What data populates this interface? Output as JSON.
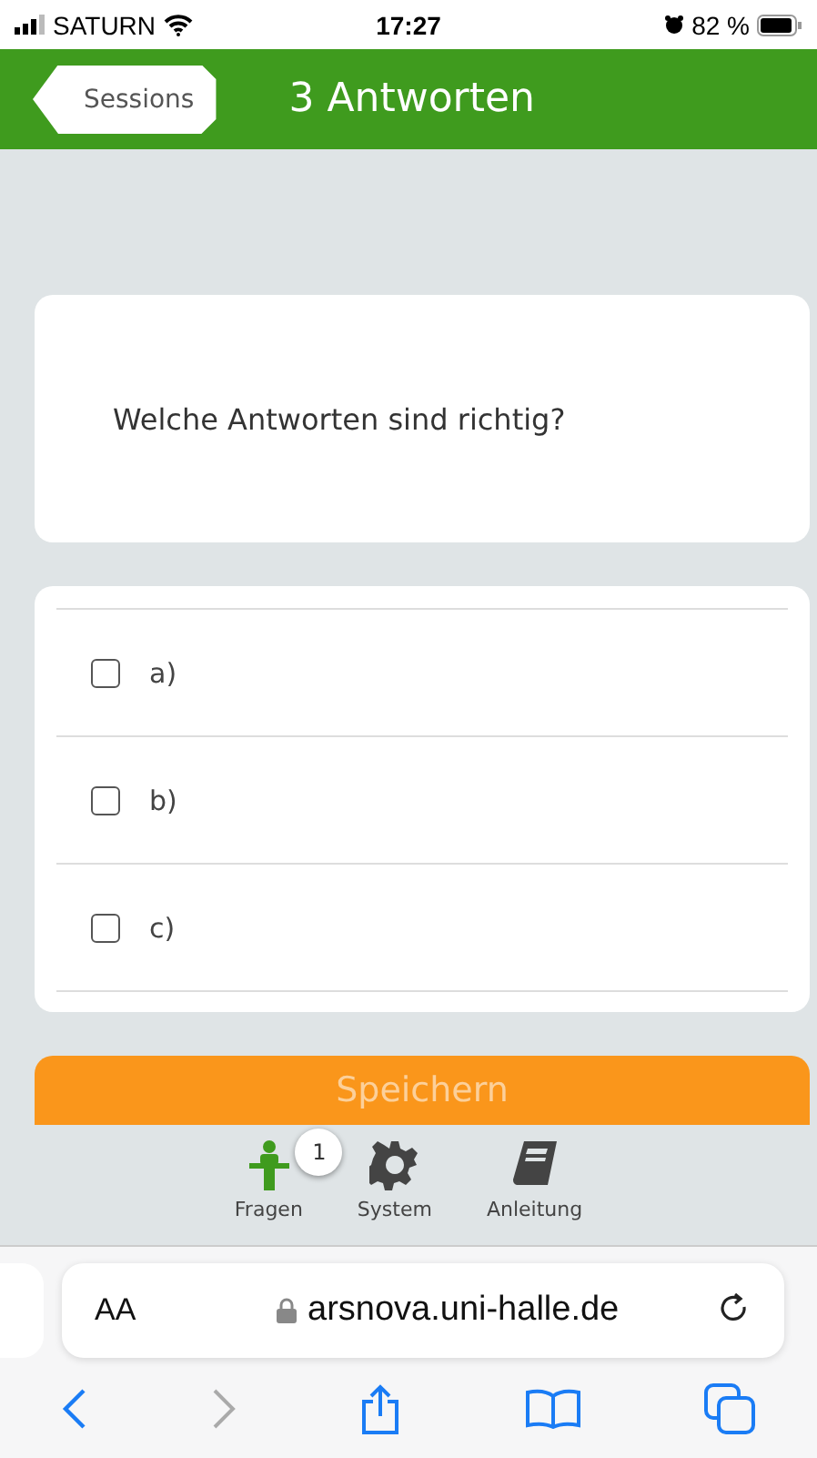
{
  "status_bar": {
    "carrier": "SATURN",
    "time": "17:27",
    "battery": "82 %"
  },
  "header": {
    "back": "Sessions",
    "title": "3 Antworten"
  },
  "question": "Welche Antworten sind richtig?",
  "options": [
    {
      "label": "a)",
      "checked": false
    },
    {
      "label": "b)",
      "checked": false
    },
    {
      "label": "c)",
      "checked": false
    }
  ],
  "save_button": "Speichern",
  "tabs": [
    {
      "label": "Fragen",
      "kind": "questions",
      "badge": "1",
      "selected": true
    },
    {
      "label": "System",
      "kind": "system",
      "selected": false
    },
    {
      "label": "Anleitung",
      "kind": "guide",
      "selected": false
    }
  ],
  "browser": {
    "text_size": "AA",
    "url": "arsnova.uni-halle.de"
  }
}
